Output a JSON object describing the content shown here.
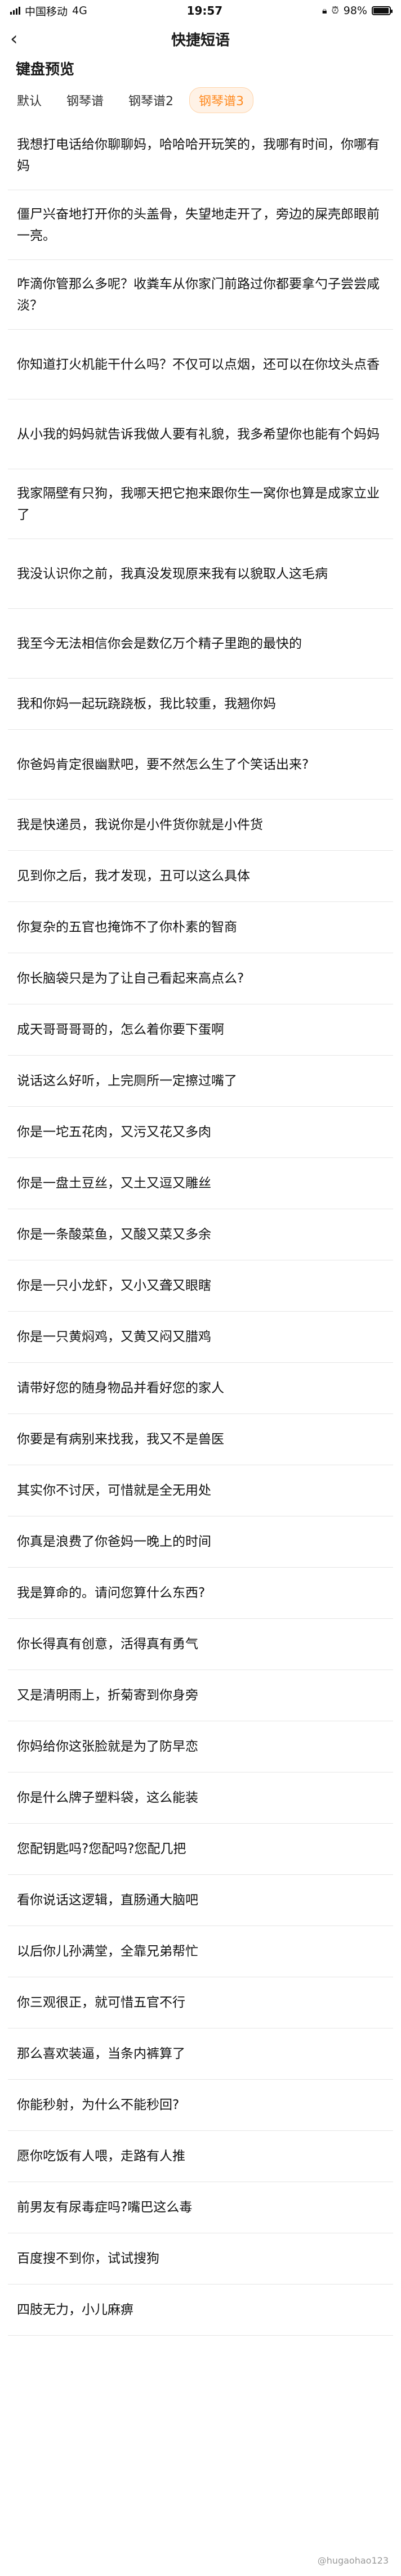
{
  "status_bar": {
    "carrier": "中国移动",
    "network": "4G",
    "time": "19:57",
    "battery_percent": "98%",
    "battery_level": 0.98
  },
  "nav": {
    "back_icon": "chevron-left-icon",
    "title": "快捷短语"
  },
  "preview_title": "键盘预览",
  "tabs": [
    {
      "label": "默认",
      "active": false
    },
    {
      "label": "钢琴谱",
      "active": false
    },
    {
      "label": "钢琴谱2",
      "active": false
    },
    {
      "label": "钢琴谱3",
      "active": true
    }
  ],
  "accent_color": "#ff8a20",
  "phrases": [
    "我想打电话给你聊聊妈，哈哈哈开玩笑的，我哪有时间，你哪有妈",
    "僵尸兴奋地打开你的头盖骨，失望地走开了，旁边的屎壳郎眼前一亮。",
    "咋滴你管那么多呢？收粪车从你家门前路过你都要拿勺子尝尝咸淡？",
    "你知道打火机能干什么吗？不仅可以点烟，还可以在你坟头点香",
    "从小我的妈妈就告诉我做人要有礼貌，我多希望你也能有个妈妈",
    "我家隔壁有只狗，我哪天把它抱来跟你生一窝你也算是成家立业了",
    "我没认识你之前，我真没发现原来我有以貌取人这毛病",
    "我至今无法相信你会是数亿万个精子里跑的最快的",
    "我和你妈一起玩跷跷板，我比较重，我翘你妈",
    "你爸妈肯定很幽默吧，要不然怎么生了个笑话出来?",
    "我是快递员，我说你是小件货你就是小件货",
    "见到你之后，我才发现，丑可以这么具体",
    "你复杂的五官也掩饰不了你朴素的智商",
    "你长脑袋只是为了让自己看起来高点么?",
    "成天哥哥哥哥的，怎么着你要下蛋啊",
    "说话这么好听，上完厕所一定擦过嘴了",
    "你是一坨五花肉，又污又花又多肉",
    "你是一盘土豆丝，又土又逗又雕丝",
    "你是一条酸菜鱼，又酸又菜又多余",
    "你是一只小龙虾，又小又聋又眼瞎",
    "你是一只黄焖鸡，又黄又闷又腊鸡",
    "请带好您的随身物品并看好您的家人",
    "你要是有病别来找我，我又不是兽医",
    "其实你不讨厌，可惜就是全无用处",
    "你真是浪费了你爸妈一晚上的时间",
    "我是算命的。请问您算什么东西?",
    "你长得真有创意，活得真有勇气",
    "又是清明雨上，折菊寄到你身旁",
    "你妈给你这张脸就是为了防早恋",
    "你是什么牌子塑料袋，这么能装",
    "您配钥匙吗?您配吗?您配几把",
    "看你说话这逻辑，直肠通大脑吧",
    "以后你儿孙满堂，全靠兄弟帮忙",
    "你三观很正，就可惜五官不行",
    "那么喜欢装逼，当条内裤算了",
    "你能秒射，为什么不能秒回?",
    "愿你吃饭有人喂，走路有人推",
    "前男友有尿毒症吗?嘴巴这么毒",
    "百度搜不到你，试试搜狗",
    "四肢无力，小儿麻痹"
  ],
  "watermark": "@hugaohao123"
}
